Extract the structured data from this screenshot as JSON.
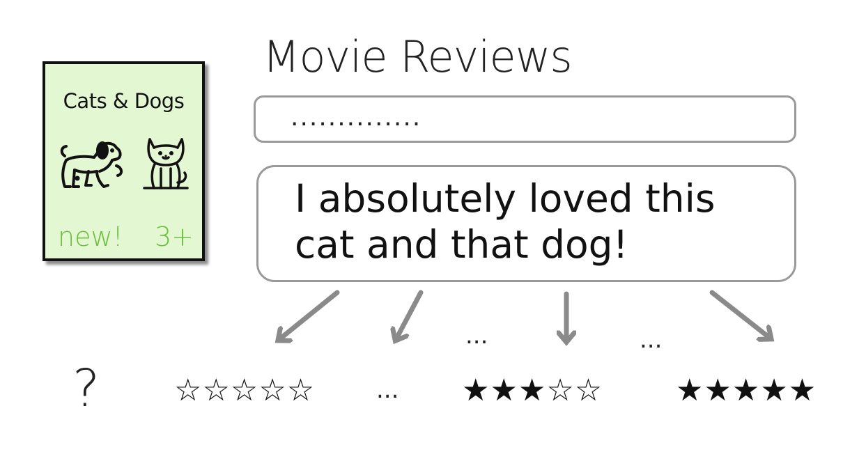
{
  "poster": {
    "title": "Cats & Dogs",
    "badge_new": "new!",
    "badge_age": "3+",
    "icons": [
      "dog-icon",
      "cat-icon"
    ],
    "background_color": "#e2f7d2",
    "badge_color": "#6cbf3a"
  },
  "header": {
    "title": "Movie Reviews"
  },
  "input": {
    "value": ".............."
  },
  "review": {
    "line1": "I absolutely loved this",
    "line2": "cat and that dog!"
  },
  "ratings": {
    "unknown": "?",
    "zero": "☆☆☆☆☆",
    "ellipsis_left": "...",
    "three": "★★★☆☆",
    "five": "★★★★★",
    "arrow_ellipsis_1": "...",
    "arrow_ellipsis_2": "..."
  }
}
